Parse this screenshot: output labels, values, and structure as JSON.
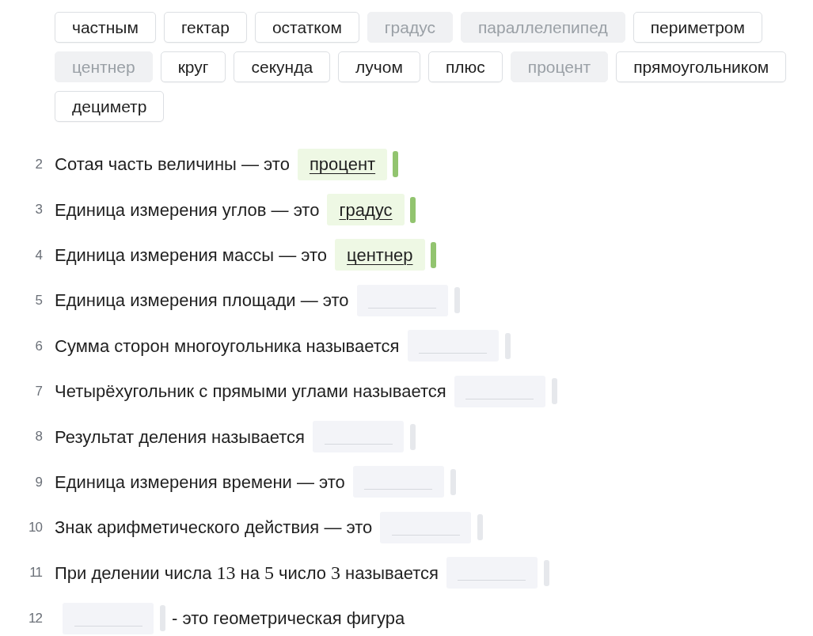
{
  "word_bank": [
    {
      "word": "частным",
      "used": false
    },
    {
      "word": "гектар",
      "used": false
    },
    {
      "word": "остатком",
      "used": false
    },
    {
      "word": "градус",
      "used": true
    },
    {
      "word": "параллелепипед",
      "used": true
    },
    {
      "word": "периметром",
      "used": false
    },
    {
      "word": "центнер",
      "used": true
    },
    {
      "word": "круг",
      "used": false
    },
    {
      "word": "секунда",
      "used": false
    },
    {
      "word": "лучом",
      "used": false
    },
    {
      "word": "плюс",
      "used": false
    },
    {
      "word": "процент",
      "used": true
    },
    {
      "word": "прямоугольником",
      "used": false
    },
    {
      "word": "дециметр",
      "used": false
    }
  ],
  "questions": [
    {
      "number": "2",
      "parts": [
        {
          "kind": "text",
          "text": "Сотая часть величины — это"
        },
        {
          "kind": "blank",
          "answer": "процент"
        }
      ]
    },
    {
      "number": "3",
      "parts": [
        {
          "kind": "text",
          "text": "Единица измерения углов — это"
        },
        {
          "kind": "blank",
          "answer": "градус"
        }
      ]
    },
    {
      "number": "4",
      "parts": [
        {
          "kind": "text",
          "text": "Единица измерения массы — это"
        },
        {
          "kind": "blank",
          "answer": "центнер"
        }
      ]
    },
    {
      "number": "5",
      "parts": [
        {
          "kind": "text",
          "text": "Единица измерения площади — это"
        },
        {
          "kind": "blank"
        }
      ]
    },
    {
      "number": "6",
      "parts": [
        {
          "kind": "text",
          "text": "Сумма сторон многоугольника называется"
        },
        {
          "kind": "blank"
        }
      ]
    },
    {
      "number": "7",
      "parts": [
        {
          "kind": "text",
          "text": "Четырёхугольник с прямыми углами называется"
        },
        {
          "kind": "blank"
        }
      ]
    },
    {
      "number": "8",
      "parts": [
        {
          "kind": "text",
          "text": "Результат деления называется"
        },
        {
          "kind": "blank"
        }
      ]
    },
    {
      "number": "9",
      "parts": [
        {
          "kind": "text",
          "text": "Единица измерения времени — это"
        },
        {
          "kind": "blank"
        }
      ]
    },
    {
      "number": "10",
      "parts": [
        {
          "kind": "text",
          "text": "Знак арифметического действия — это"
        },
        {
          "kind": "blank"
        }
      ]
    },
    {
      "number": "11",
      "parts": [
        {
          "kind": "text",
          "text": "При делении числа"
        },
        {
          "kind": "math",
          "text": "13"
        },
        {
          "kind": "text",
          "text": "на"
        },
        {
          "kind": "math",
          "text": "5"
        },
        {
          "kind": "text",
          "text": "число"
        },
        {
          "kind": "math",
          "text": "3"
        },
        {
          "kind": "text",
          "text": "называется"
        },
        {
          "kind": "blank"
        }
      ]
    },
    {
      "number": "12",
      "parts": [
        {
          "kind": "blank"
        },
        {
          "kind": "text",
          "text": "- это геометрическая фигура"
        }
      ]
    }
  ]
}
